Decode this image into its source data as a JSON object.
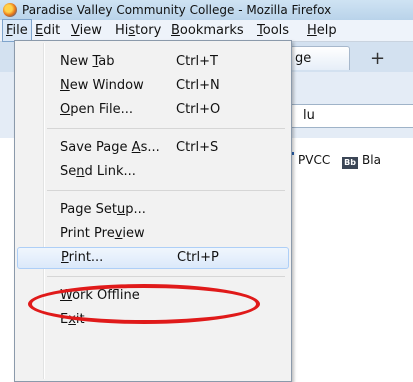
{
  "window": {
    "title": "Paradise Valley Community College - Mozilla Firefox"
  },
  "menubar": {
    "items": [
      {
        "pre": "",
        "key": "F",
        "post": "ile"
      },
      {
        "pre": "",
        "key": "E",
        "post": "dit"
      },
      {
        "pre": "",
        "key": "V",
        "post": "iew"
      },
      {
        "pre": "Hi",
        "key": "s",
        "post": "tory"
      },
      {
        "pre": "",
        "key": "B",
        "post": "ookmarks"
      },
      {
        "pre": "",
        "key": "T",
        "post": "ools"
      },
      {
        "pre": "",
        "key": "H",
        "post": "elp"
      }
    ]
  },
  "background": {
    "tab_label": "ge",
    "newtab_symbol": "+",
    "url_fragment": "lu",
    "bookmarks": {
      "pvcc": "PVCC",
      "bb_icon_text": "Bb",
      "bb_label": "Bla"
    }
  },
  "file_menu": {
    "items": [
      {
        "pre": "New ",
        "key": "T",
        "post": "ab",
        "shortcut": "Ctrl+T"
      },
      {
        "pre": "",
        "key": "N",
        "post": "ew Window",
        "shortcut": "Ctrl+N"
      },
      {
        "pre": "",
        "key": "O",
        "post": "pen File...",
        "shortcut": "Ctrl+O"
      },
      {
        "pre": "Save Page ",
        "key": "A",
        "post": "s...",
        "shortcut": "Ctrl+S"
      },
      {
        "pre": "Se",
        "key": "n",
        "post": "d Link...",
        "shortcut": ""
      },
      {
        "pre": "Page Set",
        "key": "u",
        "post": "p...",
        "shortcut": ""
      },
      {
        "pre": "Print Pre",
        "key": "v",
        "post": "iew",
        "shortcut": ""
      },
      {
        "pre": "",
        "key": "P",
        "post": "rint...",
        "shortcut": "Ctrl+P"
      },
      {
        "pre": "",
        "key": "W",
        "post": "ork Offline",
        "shortcut": ""
      },
      {
        "pre": "E",
        "key": "x",
        "post": "it",
        "shortcut": ""
      }
    ]
  },
  "colors": {
    "annotation": "#e01a1a",
    "hover_border": "#aecff7",
    "menu_background": "#f2f2f2"
  }
}
